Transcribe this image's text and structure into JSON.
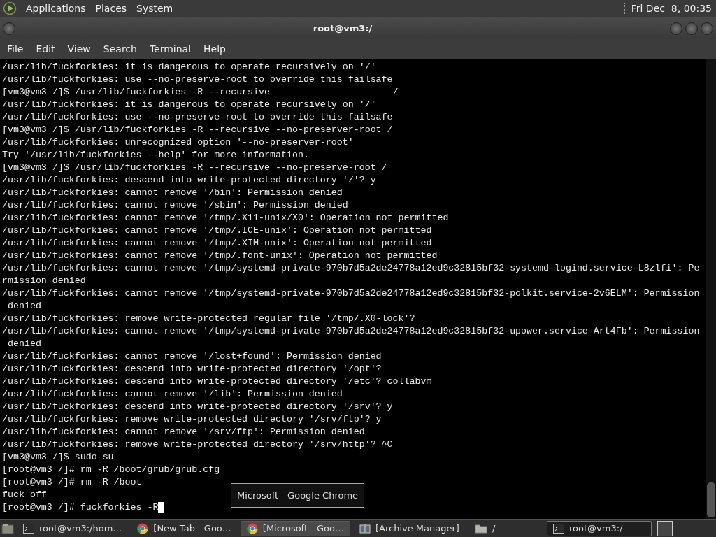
{
  "top_panel": {
    "menus": [
      "Applications",
      "Places",
      "System"
    ],
    "clock": "Fri Dec  8, 00:35"
  },
  "window": {
    "title": "root@vm3:/"
  },
  "menubar": [
    "File",
    "Edit",
    "View",
    "Search",
    "Terminal",
    "Help"
  ],
  "terminal": {
    "lines": [
      "/usr/lib/fuckforkies: it is dangerous to operate recursively on '/'",
      "/usr/lib/fuckforkies: use --no-preserve-root to override this failsafe",
      "[vm3@vm3 /]$ /usr/lib/fuckforkies -R --recursive                      /",
      "/usr/lib/fuckforkies: it is dangerous to operate recursively on '/'",
      "/usr/lib/fuckforkies: use --no-preserve-root to override this failsafe",
      "[vm3@vm3 /]$ /usr/lib/fuckforkies -R --recursive --no-preserver-root /",
      "/usr/lib/fuckforkies: unrecognized option '--no-preserver-root'",
      "Try '/usr/lib/fuckforkies --help' for more information.",
      "[vm3@vm3 /]$ /usr/lib/fuckforkies -R --recursive --no-preserve-root /",
      "/usr/lib/fuckforkies: descend into write-protected directory '/'? y",
      "/usr/lib/fuckforkies: cannot remove '/bin': Permission denied",
      "/usr/lib/fuckforkies: cannot remove '/sbin': Permission denied",
      "/usr/lib/fuckforkies: cannot remove '/tmp/.X11-unix/X0': Operation not permitted",
      "/usr/lib/fuckforkies: cannot remove '/tmp/.ICE-unix': Operation not permitted",
      "/usr/lib/fuckforkies: cannot remove '/tmp/.XIM-unix': Operation not permitted",
      "/usr/lib/fuckforkies: cannot remove '/tmp/.font-unix': Operation not permitted",
      "/usr/lib/fuckforkies: cannot remove '/tmp/systemd-private-970b7d5a2de24778a12ed9c32815bf32-systemd-logind.service-L8zlfi': Pe",
      "rmission denied",
      "/usr/lib/fuckforkies: cannot remove '/tmp/systemd-private-970b7d5a2de24778a12ed9c32815bf32-polkit.service-2v6ELM': Permission",
      " denied",
      "/usr/lib/fuckforkies: remove write-protected regular file '/tmp/.X0-lock'?",
      "/usr/lib/fuckforkies: cannot remove '/tmp/systemd-private-970b7d5a2de24778a12ed9c32815bf32-upower.service-Art4Fb': Permission",
      " denied",
      "/usr/lib/fuckforkies: cannot remove '/lost+found': Permission denied",
      "/usr/lib/fuckforkies: descend into write-protected directory '/opt'?",
      "/usr/lib/fuckforkies: descend into write-protected directory '/etc'? collabvm",
      "/usr/lib/fuckforkies: cannot remove '/lib': Permission denied",
      "/usr/lib/fuckforkies: descend into write-protected directory '/srv'? y",
      "/usr/lib/fuckforkies: remove write-protected directory '/srv/ftp'? y",
      "/usr/lib/fuckforkies: cannot remove '/srv/ftp': Permission denied",
      "/usr/lib/fuckforkies: remove write-protected directory '/srv/http'? ^C",
      "[vm3@vm3 /]$ sudo su",
      "[root@vm3 /]# rm -R /boot/grub/grub.cfg",
      "[root@vm3 /]# rm -R /boot",
      "fuck off",
      "[root@vm3 /]# fuckforkies -R"
    ]
  },
  "tooltip": "Microsoft - Google Chrome",
  "taskbar": {
    "items": [
      {
        "kind": "terminal",
        "label": "root@vm3:/hom…",
        "selected": false,
        "hovered": false
      },
      {
        "kind": "browser",
        "label": "[New Tab - Goo…",
        "selected": false,
        "hovered": false
      },
      {
        "kind": "browser",
        "label": "[Microsoft - Goo…",
        "selected": false,
        "hovered": true
      },
      {
        "kind": "archive",
        "label": "[Archive Manager]",
        "selected": false,
        "hovered": false
      },
      {
        "kind": "folder",
        "label": "/",
        "selected": false,
        "hovered": false
      },
      {
        "kind": "terminal",
        "label": "root@vm3:/",
        "selected": true,
        "hovered": false
      }
    ]
  }
}
